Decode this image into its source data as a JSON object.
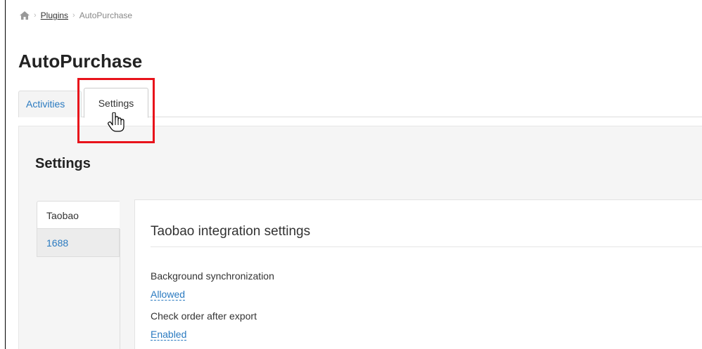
{
  "breadcrumb": {
    "icon": "home-icon",
    "items": [
      "Plugins",
      "AutoPurchase"
    ]
  },
  "page": {
    "title": "AutoPurchase"
  },
  "tabs": [
    {
      "label": "Activities",
      "active": false
    },
    {
      "label": "Settings",
      "active": true
    }
  ],
  "settings": {
    "title": "Settings",
    "subnav": [
      {
        "label": "Taobao",
        "active": true
      },
      {
        "label": "1688",
        "active": false
      }
    ],
    "section_title": "Taobao integration settings",
    "fields": [
      {
        "label": "Background synchronization",
        "value": "Allowed"
      },
      {
        "label": "Check order after export",
        "value": "Enabled"
      }
    ]
  },
  "colors": {
    "link": "#2a7ac0",
    "highlight": "#e8131b"
  }
}
